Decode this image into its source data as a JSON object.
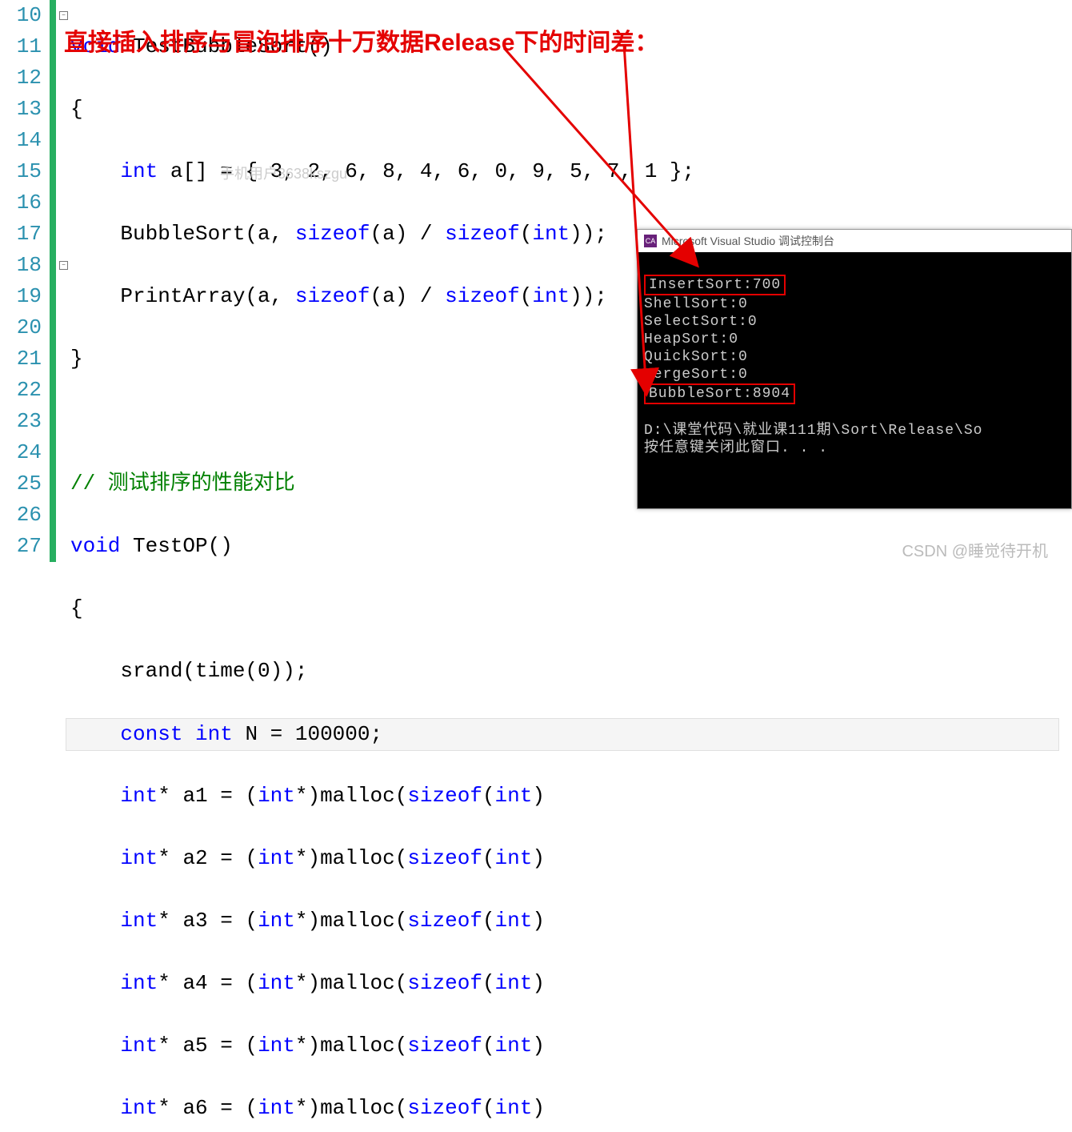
{
  "annotation": "直接插入排序与冒泡排序十万数据Release下的时间差：",
  "watermark": "手机用户3638kszgu",
  "csdn": "CSDN @睡觉待开机",
  "lineNumbers": [
    "10",
    "11",
    "12",
    "13",
    "14",
    "15",
    "16",
    "17",
    "18",
    "19",
    "20",
    "21",
    "22",
    "23",
    "24",
    "25",
    "26",
    "27"
  ],
  "code": {
    "l10_kw": "void",
    "l10_fn": " TestBubbleSort()",
    "l11": "{",
    "l12_a": "    ",
    "l12_kw": "int",
    "l12_b": " a[] = { 3, 2, 6, 8, 4, 6, 0, 9, 5, 7, 1 };",
    "l13": "    BubbleSort(a, ",
    "l13_kw": "sizeof",
    "l13_b": "(a) / ",
    "l13_kw2": "sizeof",
    "l13_c": "(",
    "l13_ty": "int",
    "l13_d": "));",
    "l14": "    PrintArray(a, ",
    "l14_kw": "sizeof",
    "l14_b": "(a) / ",
    "l14_kw2": "sizeof",
    "l14_c": "(",
    "l14_ty": "int",
    "l14_d": "));",
    "l15": "}",
    "l16": "",
    "l17": "// 测试排序的性能对比",
    "l18_kw": "void",
    "l18_fn": " TestOP()",
    "l19": "{",
    "l20": "    srand(time(0));",
    "l21_a": "    ",
    "l21_kw": "const int",
    "l21_b": " N = 100000;",
    "l22_a": "    ",
    "l22_kw": "int",
    "l22_b": "* a1 = (",
    "l22_kw2": "int",
    "l22_c": "*)malloc(",
    "l22_kw3": "sizeof",
    "l22_d": "(",
    "l22_ty": "int",
    "l22_e": ")",
    "l23_a": "    ",
    "l23_kw": "int",
    "l23_b": "* a2 = (",
    "l23_kw2": "int",
    "l23_c": "*)malloc(",
    "l23_kw3": "sizeof",
    "l23_d": "(",
    "l23_ty": "int",
    "l23_e": ")",
    "l24_a": "    ",
    "l24_kw": "int",
    "l24_b": "* a3 = (",
    "l24_kw2": "int",
    "l24_c": "*)malloc(",
    "l24_kw3": "sizeof",
    "l24_d": "(",
    "l24_ty": "int",
    "l24_e": ")",
    "l25_a": "    ",
    "l25_kw": "int",
    "l25_b": "* a4 = (",
    "l25_kw2": "int",
    "l25_c": "*)malloc(",
    "l25_kw3": "sizeof",
    "l25_d": "(",
    "l25_ty": "int",
    "l25_e": ")",
    "l26_a": "    ",
    "l26_kw": "int",
    "l26_b": "* a5 = (",
    "l26_kw2": "int",
    "l26_c": "*)malloc(",
    "l26_kw3": "sizeof",
    "l26_d": "(",
    "l26_ty": "int",
    "l26_e": ")",
    "l27_a": "    ",
    "l27_kw": "int",
    "l27_b": "* a6 = (",
    "l27_kw2": "int",
    "l27_c": "*)malloc(",
    "l27_kw3": "sizeof",
    "l27_d": "(",
    "l27_ty": "int",
    "l27_e": ")"
  },
  "console": {
    "title": "Microsoft Visual Studio 调试控制台",
    "icon": "CA",
    "lines": {
      "insert": "InsertSort:700",
      "shell": "ShellSort:0",
      "select": "SelectSort:0",
      "heap": "HeapSort:0",
      "quick": "QuickSort:0",
      "merge": "MergeSort:0",
      "bubble": "BubbleSort:8904",
      "blank": "",
      "path": "D:\\课堂代码\\就业课111期\\Sort\\Release\\So",
      "prompt": "按任意键关闭此窗口. . ."
    }
  }
}
